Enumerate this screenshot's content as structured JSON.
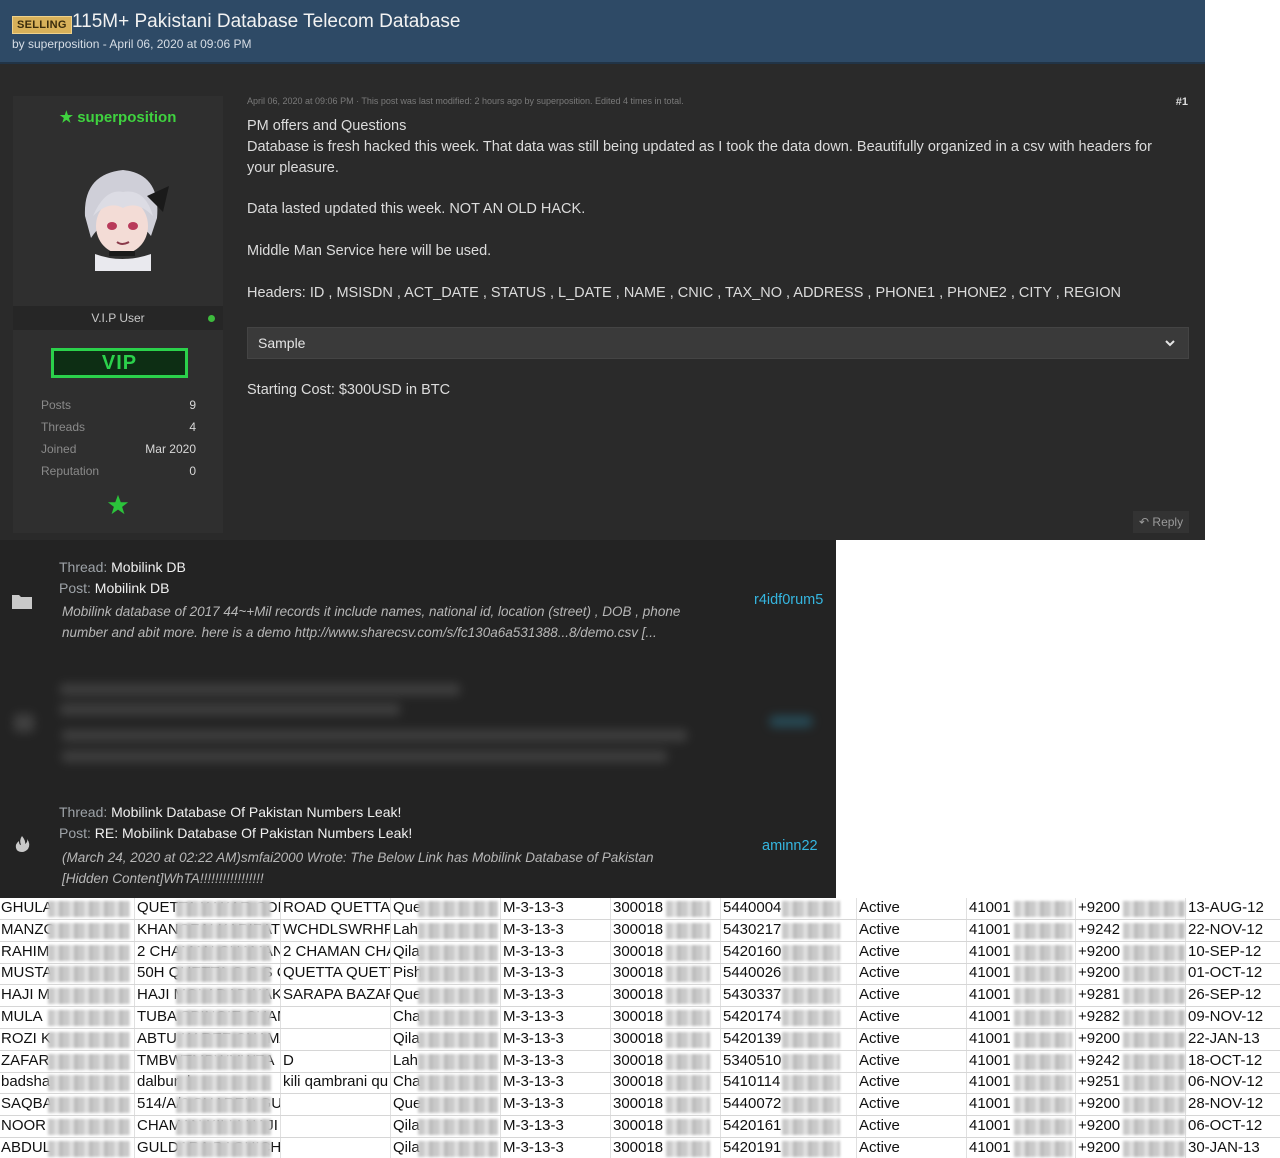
{
  "thread": {
    "badge": "SELLING",
    "title": "115M+ Pakistani Database Telecom Database",
    "byline": "by superposition - April 06, 2020 at 09:06 PM"
  },
  "user": {
    "name": "★ superposition",
    "rank": "V.I.P User",
    "vip_badge": "VIP",
    "stats": [
      {
        "label": "Posts",
        "value": "9"
      },
      {
        "label": "Threads",
        "value": "4"
      },
      {
        "label": "Joined",
        "value": "Mar 2020"
      },
      {
        "label": "Reputation",
        "value": "0"
      }
    ]
  },
  "post": {
    "meta": "April 06, 2020 at 09:06 PM · This post was last modified: 2 hours ago by superposition. Edited 4 times in total.",
    "number": "#1",
    "lines": [
      "PM offers and Questions",
      "Database is fresh hacked this week. That data was still being updated as I took the data down.  Beautifully organized in a csv with headers for",
      "your pleasure.",
      "Data lasted updated this week.  NOT AN OLD HACK.",
      "Middle Man Service here will be used.",
      "Headers: ID , MSISDN , ACT_DATE , STATUS , L_DATE , NAME , CNIC , TAX_NO , ADDRESS , PHONE1 , PHONE2 , CITY , REGION",
      "Starting Cost: $300USD in BTC"
    ],
    "spoiler_label": "Sample",
    "reply_label": "Reply"
  },
  "results": [
    {
      "thread_prefix": "Thread:",
      "thread": "Mobilink DB",
      "post_prefix": "Post:",
      "post": "Mobilink DB",
      "snippet": [
        "Mobilink database of 2017 44~+Mil records it include names, national id, location (street) , DOB , phone",
        "number and abit more. here is a demo http://www.sharecsv.com/s/fc130a6a531388...8/demo.csv [..."
      ],
      "user": "r4idf0rum5"
    },
    {
      "thread_prefix": "Thread:",
      "thread": "Mobilink Database Of Pakistan Numbers Leak!",
      "post_prefix": "Post:",
      "post": "RE: Mobilink Database Of Pakistan Numbers Leak!",
      "snippet": [
        "(March 24, 2020 at 02:22 AM)smfai2000 Wrote: The Below Link has Mobilink Database of Pakistan",
        "[Hidden Content]WhTA!!!!!!!!!!!!!!!!!"
      ],
      "user": "aminn22"
    }
  ],
  "sheet": {
    "rows": [
      [
        "GHULA",
        "QUETTA KAKAR COL",
        "ROAD QUETTA",
        "Que",
        "M-3-13-3",
        "300018",
        "5440004",
        "Active",
        "41001",
        "+9200",
        "13-AUG-12"
      ],
      [
        "MANZO",
        "KHANOZAI KARIZAT I",
        "WCHDLSWRHP:",
        "Lah",
        "M-3-13-3",
        "300018",
        "5430217",
        "Active",
        "41001",
        "+9242",
        "22-NOV-12"
      ],
      [
        "RAHIM",
        "2 CHAMAN CHAMAN",
        "2 CHAMAN CHA",
        "Qila",
        "M-3-13-3",
        "300018",
        "5420160",
        "Active",
        "41001",
        "+9200",
        "10-SEP-12"
      ],
      [
        "MUSTA",
        "50H QUETTA C G S C",
        "QUETTA QUETT",
        "Pish",
        "M-3-13-3",
        "300018",
        "5440026",
        "Active",
        "41001",
        "+9200",
        "01-OCT-12"
      ],
      [
        "HAJI M",
        "HAJI MOLADAD KAK",
        "SARAPA BAZAR",
        "Que",
        "M-3-13-3",
        "300018",
        "5430337",
        "Active",
        "41001",
        "+9281",
        "26-SEP-12"
      ],
      [
        "MULA",
        "TUBA SPINGIE CHAM",
        "",
        "Cha",
        "M-3-13-3",
        "300018",
        "5420174",
        "Active",
        "41001",
        "+9282",
        "09-NOV-12"
      ],
      [
        "ROZI K",
        "ABTU KAREZ CHAMA",
        "",
        "Qila",
        "M-3-13-3",
        "300018",
        "5420139",
        "Active",
        "41001",
        "+9200",
        "22-JAN-13"
      ],
      [
        "ZAFAR",
        "TMBWTMBWMWZA",
        "D",
        "Lah",
        "M-3-13-3",
        "300018",
        "5340510",
        "Active",
        "41001",
        "+9242",
        "18-OCT-12"
      ],
      [
        "badsha",
        "dalbundeen",
        "kili qambrani qu",
        "Cha",
        "M-3-13-3",
        "300018",
        "5410114",
        "Active",
        "41001",
        "+9251",
        "06-NOV-12"
      ],
      [
        "SAQBA",
        "514/A/6 SHAREH GU",
        "",
        "Que",
        "M-3-13-3",
        "300018",
        "5440072",
        "Active",
        "41001",
        "+9200",
        "28-NOV-12"
      ],
      [
        "NOOR",
        "CHAMAN KILLI HAJI I",
        "",
        "Qila",
        "M-3-13-3",
        "300018",
        "5420161",
        "Active",
        "41001",
        "+9200",
        "06-OCT-12"
      ],
      [
        "ABDUL",
        "GULDARA BAGHICHA",
        "",
        "Qila",
        "M-3-13-3",
        "300018",
        "5420191",
        "Active",
        "41001",
        "+9200",
        "30-JAN-13"
      ]
    ]
  },
  "colors": {
    "header": "#2e4a66",
    "accent_green": "#2bd14b",
    "link_blue": "#35b6e0"
  }
}
